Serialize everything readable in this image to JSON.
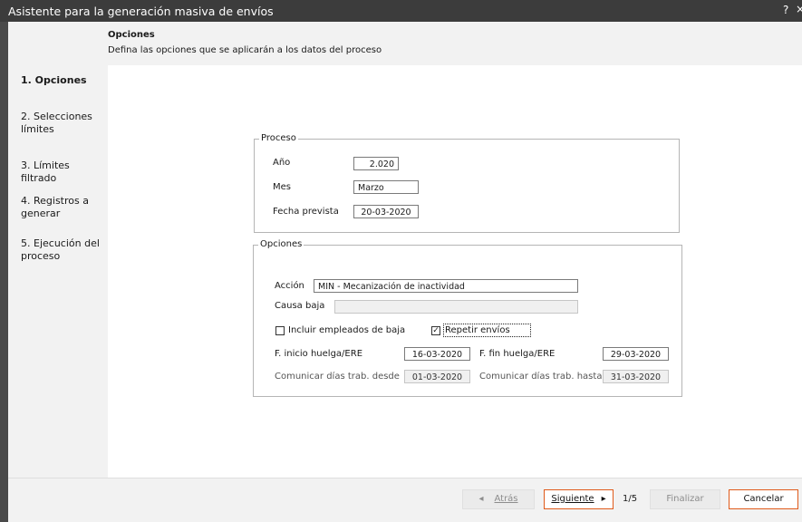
{
  "window": {
    "title": "Asistente para la generación masiva de envíos",
    "help": "?",
    "close": "×"
  },
  "header": {
    "title": "Opciones",
    "description": "Defina las opciones que se aplicarán a los datos del proceso"
  },
  "steps": [
    {
      "label": "1. Opciones",
      "active": true
    },
    {
      "label": "2. Selecciones límites",
      "active": false
    },
    {
      "label": "3. Límites filtrado",
      "active": false
    },
    {
      "label": "4. Registros a generar",
      "active": false
    },
    {
      "label": "5. Ejecución del proceso",
      "active": false
    }
  ],
  "proceso": {
    "legend": "Proceso",
    "anio_label": "Año",
    "anio_value": "2.020",
    "mes_label": "Mes",
    "mes_value": "Marzo",
    "fecha_label": "Fecha prevista",
    "fecha_value": "20-03-2020"
  },
  "opciones": {
    "legend": "Opciones",
    "accion_label": "Acción",
    "accion_value": "MIN - Mecanización de inactividad",
    "causa_label": "Causa baja",
    "causa_value": "",
    "incluir_label": "Incluir empleados de baja",
    "incluir_checked": false,
    "repetir_label": "Repetir envíos",
    "repetir_checked": true,
    "repetir_mark": "✓",
    "inicio_huelga_label": "F. inicio huelga/ERE",
    "inicio_huelga_value": "16-03-2020",
    "fin_huelga_label": "F. fin huelga/ERE",
    "fin_huelga_value": "29-03-2020",
    "desde_label": "Comunicar días trab. desde",
    "desde_value": "01-03-2020",
    "hasta_label": "Comunicar días trab. hasta",
    "hasta_value": "31-03-2020"
  },
  "footer": {
    "back_icon": "◂",
    "back_label": "Atrás",
    "next_label": "Siguiente",
    "next_icon": "▸",
    "page": "1/5",
    "finish_label": "Finalizar",
    "cancel_label": "Cancelar"
  }
}
